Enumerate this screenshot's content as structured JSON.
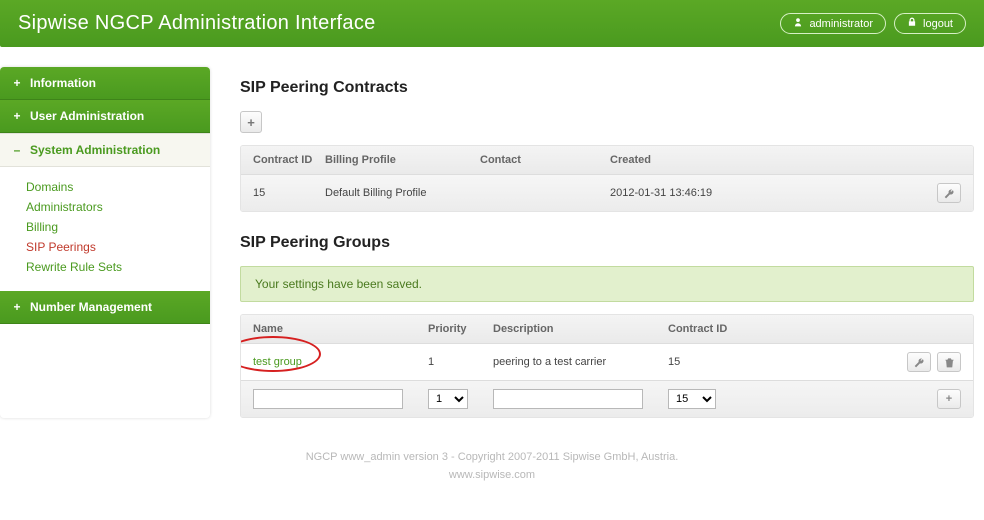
{
  "header": {
    "title": "Sipwise NGCP Administration Interface",
    "user_label": "administrator",
    "logout_label": "logout"
  },
  "nav": {
    "items": [
      {
        "label": "Information",
        "expanded": false
      },
      {
        "label": "User Administration",
        "expanded": false
      },
      {
        "label": "System Administration",
        "expanded": true
      },
      {
        "label": "Number Management",
        "expanded": false
      }
    ],
    "sub": [
      {
        "label": "Domains",
        "active": false
      },
      {
        "label": "Administrators",
        "active": false
      },
      {
        "label": "Billing",
        "active": false
      },
      {
        "label": "SIP Peerings",
        "active": true
      },
      {
        "label": "Rewrite Rule Sets",
        "active": false
      }
    ]
  },
  "contracts": {
    "heading": "SIP Peering Contracts",
    "cols": {
      "id": "Contract ID",
      "profile": "Billing Profile",
      "contact": "Contact",
      "created": "Created"
    },
    "rows": [
      {
        "id": "15",
        "profile": "Default Billing Profile",
        "contact": "",
        "created": "2012-01-31 13:46:19"
      }
    ]
  },
  "groups": {
    "heading": "SIP Peering Groups",
    "alert": "Your settings have been saved.",
    "cols": {
      "name": "Name",
      "priority": "Priority",
      "description": "Description",
      "contract": "Contract ID"
    },
    "rows": [
      {
        "name": "test group",
        "priority": "1",
        "description": "peering to a test carrier",
        "contract": "15"
      }
    ],
    "input": {
      "name_value": "",
      "priority_options": [
        "1"
      ],
      "priority_value": "1",
      "description_value": "",
      "contract_options": [
        "15"
      ],
      "contract_value": "15"
    }
  },
  "footer": {
    "line1": "NGCP www_admin version 3 - Copyright 2007-2011 Sipwise GmbH, Austria.",
    "line2": "www.sipwise.com"
  }
}
